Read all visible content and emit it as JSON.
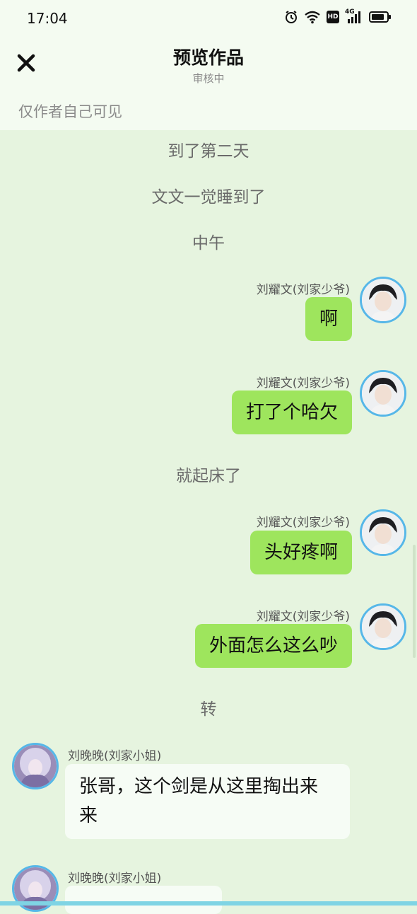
{
  "status_bar": {
    "time": "17:04",
    "icons": [
      "alarm-icon",
      "wifi-icon",
      "hd-icon",
      "signal-4g-icon",
      "battery-icon"
    ],
    "network_label": "4G",
    "hd_label": "HD"
  },
  "header": {
    "close_icon": "close-icon",
    "title": "预览作品",
    "subtitle": "审核中",
    "visibility": "仅作者自己可见"
  },
  "feed": {
    "narrations": [
      "到了第二天",
      "文文一觉睡到了",
      "中午",
      "就起床了",
      "转"
    ],
    "messages": [
      {
        "speaker": "刘耀文(刘家少爷)",
        "text": "啊",
        "side": "right"
      },
      {
        "speaker": "刘耀文(刘家少爷)",
        "text": "打了个哈欠",
        "side": "right"
      },
      {
        "speaker": "刘耀文(刘家少爷)",
        "text": "头好疼啊",
        "side": "right"
      },
      {
        "speaker": "刘耀文(刘家少爷)",
        "text": "外面怎么这么吵",
        "side": "right"
      },
      {
        "speaker": "刘晚晚(刘家小姐)",
        "text_line1": "张哥，这个剑是从这里掏出来",
        "text_line2": "来",
        "side": "left"
      },
      {
        "speaker": "刘晚晚(刘家小姐)",
        "text": "",
        "side": "left"
      }
    ]
  },
  "colors": {
    "background": "#e6f4df",
    "header_background": "#f4fbf1",
    "bubble_right": "#9ee55d",
    "bubble_left": "#f6fcf5",
    "avatar_ring": "#56b7e8"
  }
}
